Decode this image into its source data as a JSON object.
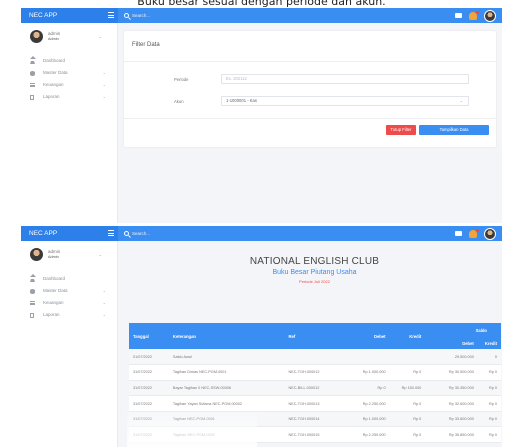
{
  "caption": "Buku besar sesuai dengan periode dan akun.",
  "app": {
    "brand": "NEC APP",
    "search_placeholder": "Search...",
    "user": {
      "name": "admin",
      "role": "Admin"
    },
    "menu": [
      {
        "label": "Dashboard",
        "icon": "home-icon",
        "has_children": false
      },
      {
        "label": "Master Data",
        "icon": "database-icon",
        "has_children": true
      },
      {
        "label": "Keuangan",
        "icon": "money-icon",
        "has_children": true
      },
      {
        "label": "Laporan",
        "icon": "document-icon",
        "has_children": true
      }
    ]
  },
  "filter": {
    "title": "Filter Data",
    "periode_label": "Periode",
    "periode_placeholder": "Ex. 202112",
    "akun_label": "Akun",
    "akun_value": "1-1000001 - Kas",
    "close_button": "Tutup Filter",
    "show_button": "Tampilkan Data"
  },
  "report": {
    "title": "NATIONAL ENGLISH CLUB",
    "subtitle": "Buku Besar Piutang Usaha",
    "period": "Periode Juli 2022",
    "headers": {
      "tanggal": "Tanggal",
      "keterangan": "Keterangan",
      "ref": "Ref",
      "debet": "Debet",
      "kredit": "Kredit",
      "saldo": "Saldo",
      "saldo_debet": "Debet",
      "saldo_kredit": "Kredit"
    },
    "rows": [
      [
        "01/07/2022",
        "Saldo Awal",
        "",
        "",
        "",
        "29.500.000",
        "0"
      ],
      [
        "31/07/2022",
        "Tagihan Dimas NEC-PGM.0001",
        "NEC-TGH.000012",
        "Rp 1.000.000",
        "Rp 0",
        "Rp 30.500.000",
        "Rp 0"
      ],
      [
        "31/07/2022",
        "Bayar Tagihan 0 NEC-SSW-00006",
        "NEC-BILL.000012",
        "Rp 0",
        "Rp 150.000",
        "Rp 30.350.000",
        "Rp 0"
      ],
      [
        "31/07/2022",
        "Tagihan Yayan Sutisna NEC-PGM.00002",
        "NEC-TGH.000013",
        "Rp 2.250.000",
        "Rp 0",
        "Rp 32.600.000",
        "Rp 0"
      ],
      [
        "31/07/2022",
        "Tagihan NEC-PGM-0001",
        "NEC-TGH.000014",
        "Rp 1.000.000",
        "Rp 0",
        "Rp 33.600.000",
        "Rp 0"
      ],
      [
        "31/07/2022",
        "Tagihan NEC-PGM-0002",
        "NEC-TGH.000015",
        "Rp 2.250.000",
        "Rp 0",
        "Rp 35.850.000",
        "Rp 0"
      ]
    ]
  },
  "colors": {
    "primary": "#3a8df1",
    "danger": "#ee4b4b"
  }
}
